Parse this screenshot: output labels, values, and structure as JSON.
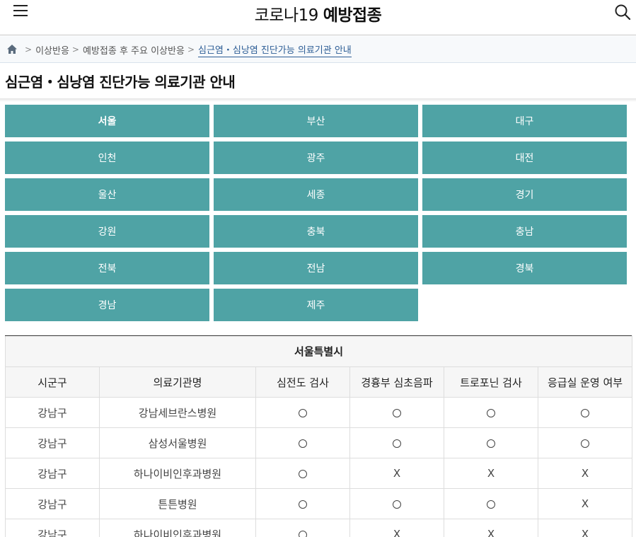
{
  "header": {
    "title_normal": "코로나19",
    "title_bold": "예방접종"
  },
  "breadcrumb": {
    "items": [
      "이상반응",
      "예방접종 후 주요 이상반응"
    ],
    "current": "심근염・심낭염 진단가능 의료기관 안내"
  },
  "page_title": "심근염・심낭염 진단가능 의료기관 안내",
  "regions": [
    {
      "label": "서울",
      "active": true
    },
    {
      "label": "부산"
    },
    {
      "label": "대구"
    },
    {
      "label": "인천"
    },
    {
      "label": "광주"
    },
    {
      "label": "대전"
    },
    {
      "label": "울산"
    },
    {
      "label": "세종"
    },
    {
      "label": "경기"
    },
    {
      "label": "강원"
    },
    {
      "label": "충북"
    },
    {
      "label": "충남"
    },
    {
      "label": "전북"
    },
    {
      "label": "전남"
    },
    {
      "label": "경북"
    },
    {
      "label": "경남"
    },
    {
      "label": "제주"
    }
  ],
  "table": {
    "caption": "서울특별시",
    "columns": [
      "시군구",
      "의료기관명",
      "심전도 검사",
      "경흉부 심초음파",
      "트로포닌 검사",
      "응급실 운영 여부"
    ],
    "rows": [
      [
        "강남구",
        "강남세브란스병원",
        "○",
        "○",
        "○",
        "○"
      ],
      [
        "강남구",
        "삼성서울병원",
        "○",
        "○",
        "○",
        "○"
      ],
      [
        "강남구",
        "하나이비인후과병원",
        "○",
        "X",
        "X",
        "X"
      ],
      [
        "강남구",
        "튼튼병원",
        "○",
        "○",
        "○",
        "X"
      ],
      [
        "강남구",
        "하나이비인후과병원",
        "○",
        "X",
        "X",
        "X"
      ]
    ]
  },
  "colors": {
    "region_button": "#4fa3a5",
    "breadcrumb_current": "#2e5e96"
  },
  "icons": {
    "menu": "hamburger-icon",
    "search": "search-icon",
    "home": "home-icon",
    "available": "circle-mark",
    "unavailable": "x-mark"
  }
}
